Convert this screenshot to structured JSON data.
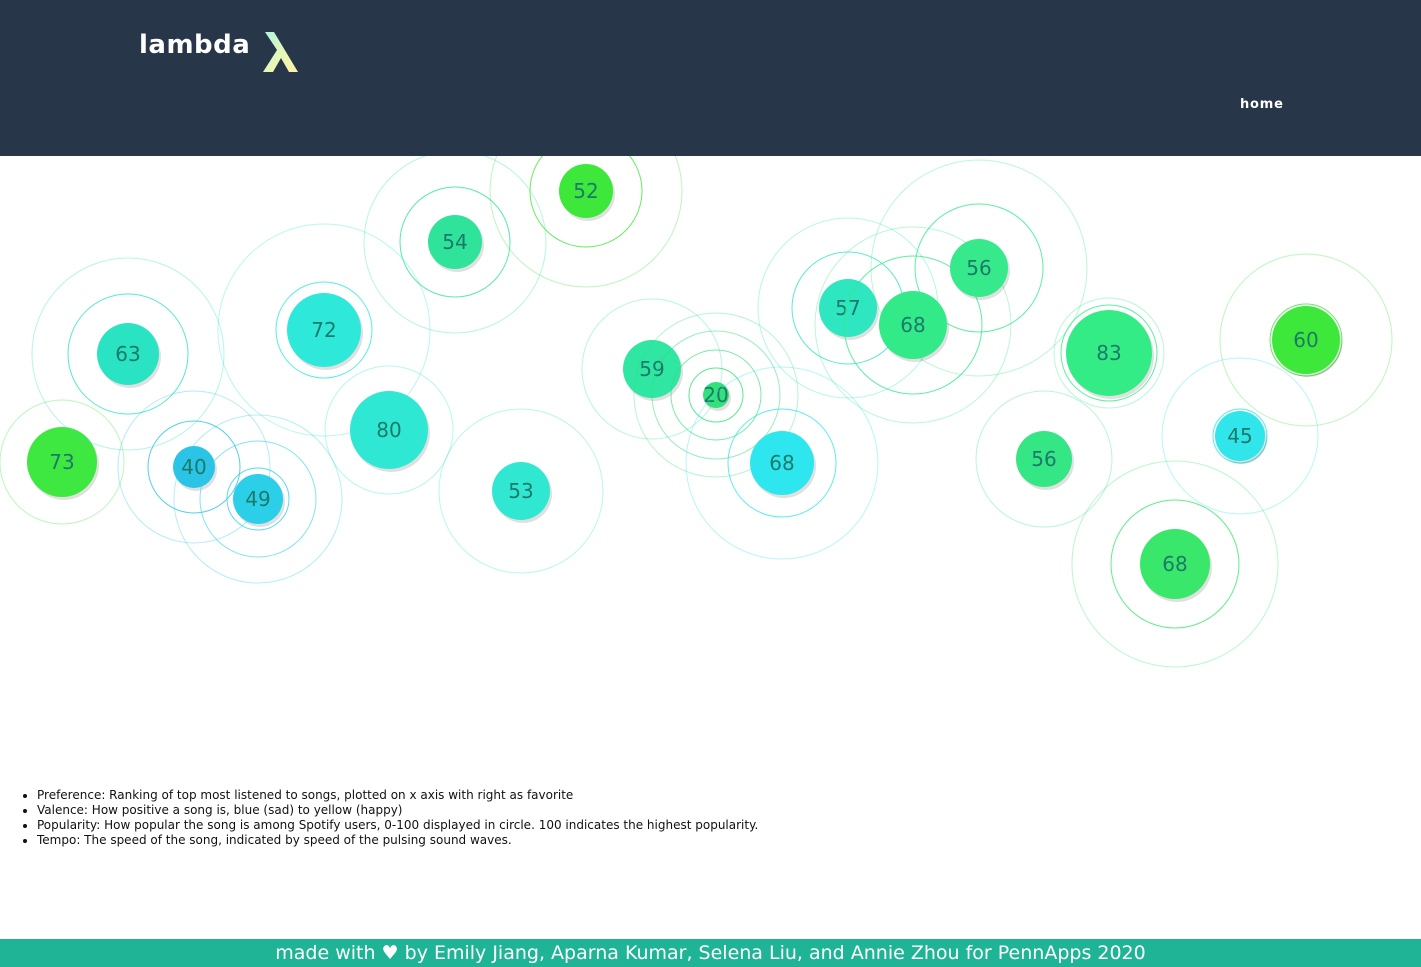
{
  "nav": {
    "brand": "lambda",
    "home_label": "home"
  },
  "colors": {
    "navbar": "#273649",
    "footer": "#1fb495"
  },
  "legend": [
    "Preference: Ranking of top most listened to songs, plotted on x axis with right as favorite",
    "Valence: How positive a song is, blue (sad) to yellow (happy)",
    "Popularity: How popular the song is among Spotify users, 0-100 displayed in circle. 100 indicates the highest popularity.",
    "Tempo: The speed of the song, indicated by speed of the pulsing sound waves."
  ],
  "songs": [
    {
      "popularity": 73,
      "color": "#3ee840"
    },
    {
      "popularity": 63,
      "color": "#2ae3c2"
    },
    {
      "popularity": 40,
      "color": "#2bc4e6"
    },
    {
      "popularity": 49,
      "color": "#2ccfe8"
    },
    {
      "popularity": 72,
      "color": "#2ee8da"
    },
    {
      "popularity": 80,
      "color": "#2ee8d4"
    },
    {
      "popularity": 54,
      "color": "#2fe49a"
    },
    {
      "popularity": 53,
      "color": "#30e8d2"
    },
    {
      "popularity": 52,
      "color": "#3ee83a"
    },
    {
      "popularity": 59,
      "color": "#2fe6a2"
    },
    {
      "popularity": 20,
      "color": "#33e07a"
    },
    {
      "popularity": 68,
      "color": "#2ee6ee"
    },
    {
      "popularity": 57,
      "color": "#2ee6c0"
    },
    {
      "popularity": 68,
      "color": "#33ea88"
    },
    {
      "popularity": 56,
      "color": "#36ea8c"
    },
    {
      "popularity": 56,
      "color": "#35e684"
    },
    {
      "popularity": 83,
      "color": "#34ec86"
    },
    {
      "popularity": 68,
      "color": "#39e86a"
    },
    {
      "popularity": 45,
      "color": "#30e6ea"
    },
    {
      "popularity": 60,
      "color": "#3ee83a"
    }
  ],
  "footer": {
    "text": "made with ♥ by Emily Jiang, Aparna Kumar, Selena Liu, and Annie Zhou for PennApps 2020"
  }
}
